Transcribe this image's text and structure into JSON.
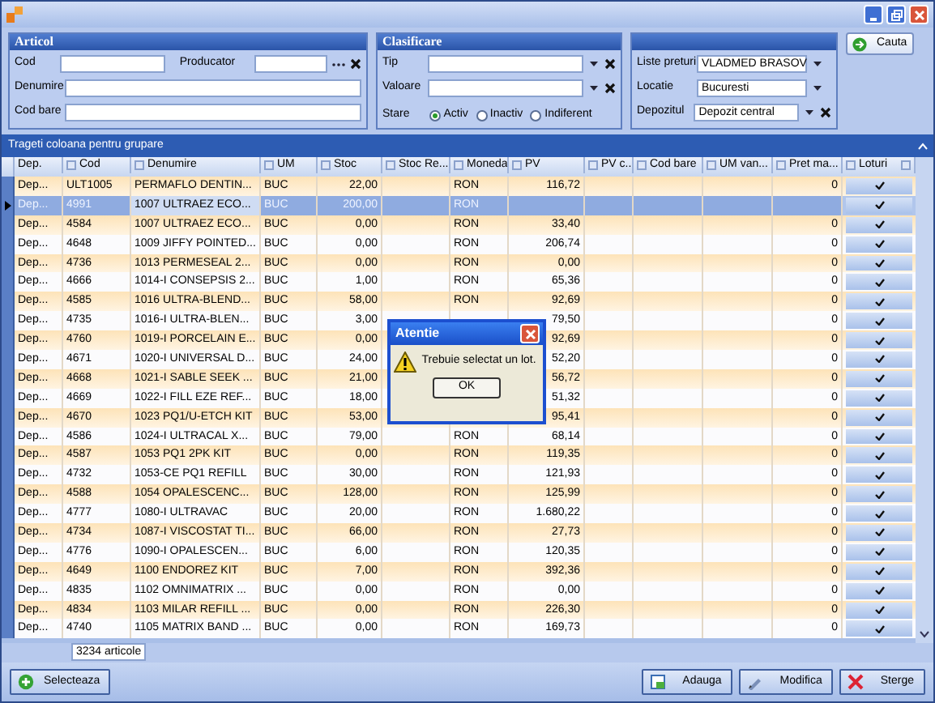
{
  "articol": {
    "title": "Articol",
    "fields": [
      {
        "label": "Cod"
      },
      {
        "label": "Producator",
        "kind": "picker"
      },
      {
        "label": "Denumire"
      },
      {
        "label": "Cod bare"
      }
    ]
  },
  "clasificare": {
    "title": "Clasificare",
    "fields": [
      {
        "label": "Tip"
      },
      {
        "label": "Valoare"
      }
    ],
    "stare_label": "Stare",
    "stare": [
      {
        "label": "Activ",
        "selected": true
      },
      {
        "label": "Inactiv",
        "selected": false
      },
      {
        "label": "Indiferent",
        "selected": false
      }
    ]
  },
  "context": {
    "fields": [
      {
        "label": "Liste preturi",
        "value": "VLADMED BRASOV",
        "clearable": false
      },
      {
        "label": "Locatie",
        "value": "Bucuresti",
        "clearable": false
      },
      {
        "label": "Depozitul",
        "value": "Depozit central",
        "clearable": true
      }
    ]
  },
  "search_button": "Cauta",
  "group_band": "Trageti coloana pentru grupare",
  "columns": [
    "Dep.",
    "Cod",
    "Denumire",
    "UM",
    "Stoc",
    "Stoc Re...",
    "Moneda",
    "PV",
    "PV c...",
    "Cod bare",
    "UM van...",
    "Pret ma...",
    "Loturi"
  ],
  "rows": [
    {
      "dep": "Dep...",
      "cod": "ULT1005",
      "denumire": "PERMAFLO DENTIN...",
      "um": "BUC",
      "stoc": "22,00",
      "moneda": "RON",
      "pv": "116,72",
      "pret_max": "0",
      "selected": false
    },
    {
      "dep": "Dep...",
      "cod": "4991",
      "denumire": "1007 ULTRAEZ ECO...",
      "um": "BUC",
      "stoc": "200,00",
      "moneda": "RON",
      "selected": true
    },
    {
      "dep": "Dep...",
      "cod": "4584",
      "denumire": "1007 ULTRAEZ ECO...",
      "um": "BUC",
      "stoc": "0,00",
      "moneda": "RON",
      "pv": "33,40",
      "pret_max": "0",
      "selected": false
    },
    {
      "dep": "Dep...",
      "cod": "4648",
      "denumire": "1009 JIFFY POINTED...",
      "um": "BUC",
      "stoc": "0,00",
      "moneda": "RON",
      "pv": "206,74",
      "pret_max": "0",
      "selected": false
    },
    {
      "dep": "Dep...",
      "cod": "4736",
      "denumire": "1013 PERMESEAL 2...",
      "um": "BUC",
      "stoc": "0,00",
      "moneda": "RON",
      "pv": "0,00",
      "pret_max": "0",
      "selected": false
    },
    {
      "dep": "Dep...",
      "cod": "4666",
      "denumire": "1014-I CONSEPSIS 2...",
      "um": "BUC",
      "stoc": "1,00",
      "moneda": "RON",
      "pv": "65,36",
      "pret_max": "0",
      "selected": false
    },
    {
      "dep": "Dep...",
      "cod": "4585",
      "denumire": "1016 ULTRA-BLEND...",
      "um": "BUC",
      "stoc": "58,00",
      "moneda": "RON",
      "pv": "92,69",
      "pret_max": "0",
      "selected": false
    },
    {
      "dep": "Dep...",
      "cod": "4735",
      "denumire": "1016-I ULTRA-BLEN...",
      "um": "BUC",
      "stoc": "3,00",
      "pv": "79,50",
      "pret_max": "0",
      "selected": false
    },
    {
      "dep": "Dep...",
      "cod": "4760",
      "denumire": "1019-I PORCELAIN E...",
      "um": "BUC",
      "stoc": "0,00",
      "pv": "92,69",
      "pret_max": "0",
      "selected": false
    },
    {
      "dep": "Dep...",
      "cod": "4671",
      "denumire": "1020-I UNIVERSAL D...",
      "um": "BUC",
      "stoc": "24,00",
      "pv": "52,20",
      "pret_max": "0",
      "selected": false
    },
    {
      "dep": "Dep...",
      "cod": "4668",
      "denumire": "1021-I SABLE SEEK ...",
      "um": "BUC",
      "stoc": "21,00",
      "pv": "56,72",
      "pret_max": "0",
      "selected": false
    },
    {
      "dep": "Dep...",
      "cod": "4669",
      "denumire": "1022-I FILL EZE REF...",
      "um": "BUC",
      "stoc": "18,00",
      "pv": "51,32",
      "pret_max": "0",
      "selected": false
    },
    {
      "dep": "Dep...",
      "cod": "4670",
      "denumire": "1023 PQ1/U-ETCH KIT",
      "um": "BUC",
      "stoc": "53,00",
      "pv": "95,41",
      "pret_max": "0",
      "selected": false
    },
    {
      "dep": "Dep...",
      "cod": "4586",
      "denumire": "1024-I ULTRACAL X...",
      "um": "BUC",
      "stoc": "79,00",
      "moneda": "RON",
      "pv": "68,14",
      "pret_max": "0",
      "selected": false
    },
    {
      "dep": "Dep...",
      "cod": "4587",
      "denumire": "1053 PQ1 2PK KIT",
      "um": "BUC",
      "stoc": "0,00",
      "moneda": "RON",
      "pv": "119,35",
      "pret_max": "0",
      "selected": false
    },
    {
      "dep": "Dep...",
      "cod": "4732",
      "denumire": "1053-CE PQ1 REFILL",
      "um": "BUC",
      "stoc": "30,00",
      "moneda": "RON",
      "pv": "121,93",
      "pret_max": "0",
      "selected": false
    },
    {
      "dep": "Dep...",
      "cod": "4588",
      "denumire": "1054 OPALESCENC...",
      "um": "BUC",
      "stoc": "128,00",
      "moneda": "RON",
      "pv": "125,99",
      "pret_max": "0",
      "selected": false
    },
    {
      "dep": "Dep...",
      "cod": "4777",
      "denumire": "1080-I ULTRAVAC",
      "um": "BUC",
      "stoc": "20,00",
      "moneda": "RON",
      "pv": "1.680,22",
      "pret_max": "0",
      "selected": false
    },
    {
      "dep": "Dep...",
      "cod": "4734",
      "denumire": "1087-I VISCOSTAT TI...",
      "um": "BUC",
      "stoc": "66,00",
      "moneda": "RON",
      "pv": "27,73",
      "pret_max": "0",
      "selected": false
    },
    {
      "dep": "Dep...",
      "cod": "4776",
      "denumire": "1090-I OPALESCEN...",
      "um": "BUC",
      "stoc": "6,00",
      "moneda": "RON",
      "pv": "120,35",
      "pret_max": "0",
      "selected": false
    },
    {
      "dep": "Dep...",
      "cod": "4649",
      "denumire": "1100 ENDOREZ KIT",
      "um": "BUC",
      "stoc": "7,00",
      "moneda": "RON",
      "pv": "392,36",
      "pret_max": "0",
      "selected": false
    },
    {
      "dep": "Dep...",
      "cod": "4835",
      "denumire": "1102 OMNIMATRIX ...",
      "um": "BUC",
      "stoc": "0,00",
      "moneda": "RON",
      "pv": "0,00",
      "pret_max": "0",
      "selected": false
    },
    {
      "dep": "Dep...",
      "cod": "4834",
      "denumire": "1103 MILAR REFILL ...",
      "um": "BUC",
      "stoc": "0,00",
      "moneda": "RON",
      "pv": "226,30",
      "pret_max": "0",
      "selected": false
    },
    {
      "dep": "Dep...",
      "cod": "4740",
      "denumire": "1105 MATRIX BAND ...",
      "um": "BUC",
      "stoc": "0,00",
      "moneda": "RON",
      "pv": "169,73",
      "pret_max": "0",
      "selected": false
    }
  ],
  "count": "3234 articole",
  "dialog": {
    "title": "Atentie",
    "message": "Trebuie selectat un lot.",
    "button": "OK"
  },
  "bottom_buttons": [
    {
      "label": "Selecteaza",
      "kind": "select"
    },
    {
      "label": "Adauga",
      "kind": "add"
    },
    {
      "label": "Modifica",
      "kind": "edit"
    },
    {
      "label": "Sterge",
      "kind": "delete"
    }
  ]
}
